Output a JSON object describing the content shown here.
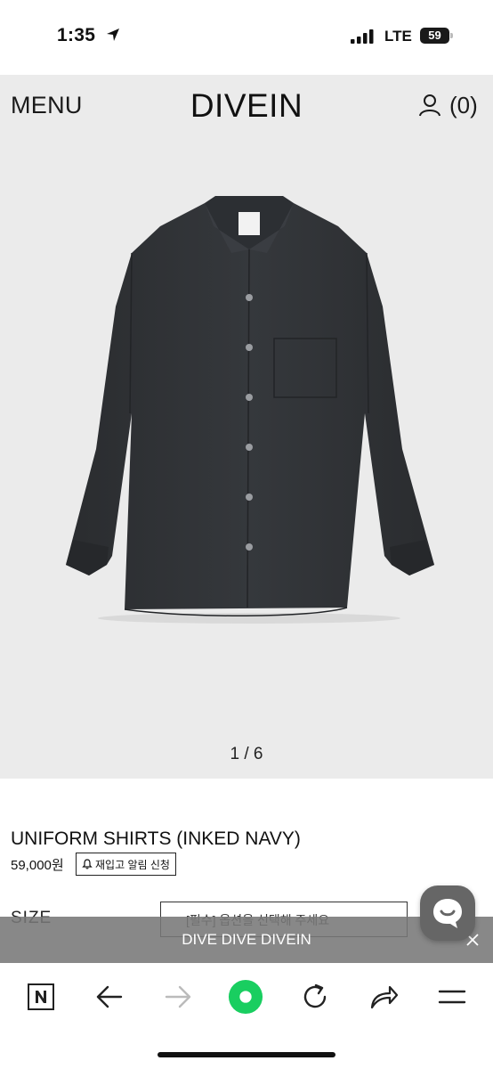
{
  "status_bar": {
    "time": "1:35",
    "network": "LTE",
    "battery": "59"
  },
  "header": {
    "menu_label": "MENU",
    "brand": "DIVEIN",
    "cart_count": "(0)"
  },
  "gallery": {
    "counter": "1 / 6",
    "image_icon": "shirt-image",
    "shirt_color": "#2e3033"
  },
  "product": {
    "name": "UNIFORM SHIRTS (INKED NAVY)",
    "price": "59,000원",
    "restock_button_label": "재입고 알림 신청",
    "size_label": "SIZE",
    "option_placeholder": "[필수] 옵션을 선택해 주세요"
  },
  "banner": {
    "text": "DIVE DIVE DIVEIN"
  },
  "browser_toolbar": {
    "items": [
      "naver-icon",
      "back-arrow-icon",
      "forward-arrow-icon",
      "green-home-icon",
      "refresh-icon",
      "share-icon",
      "menu-lines-icon"
    ],
    "accent": "#19ce60"
  },
  "colors": {
    "header_bg": "#ebebeb",
    "banner_bg": "#787878"
  }
}
